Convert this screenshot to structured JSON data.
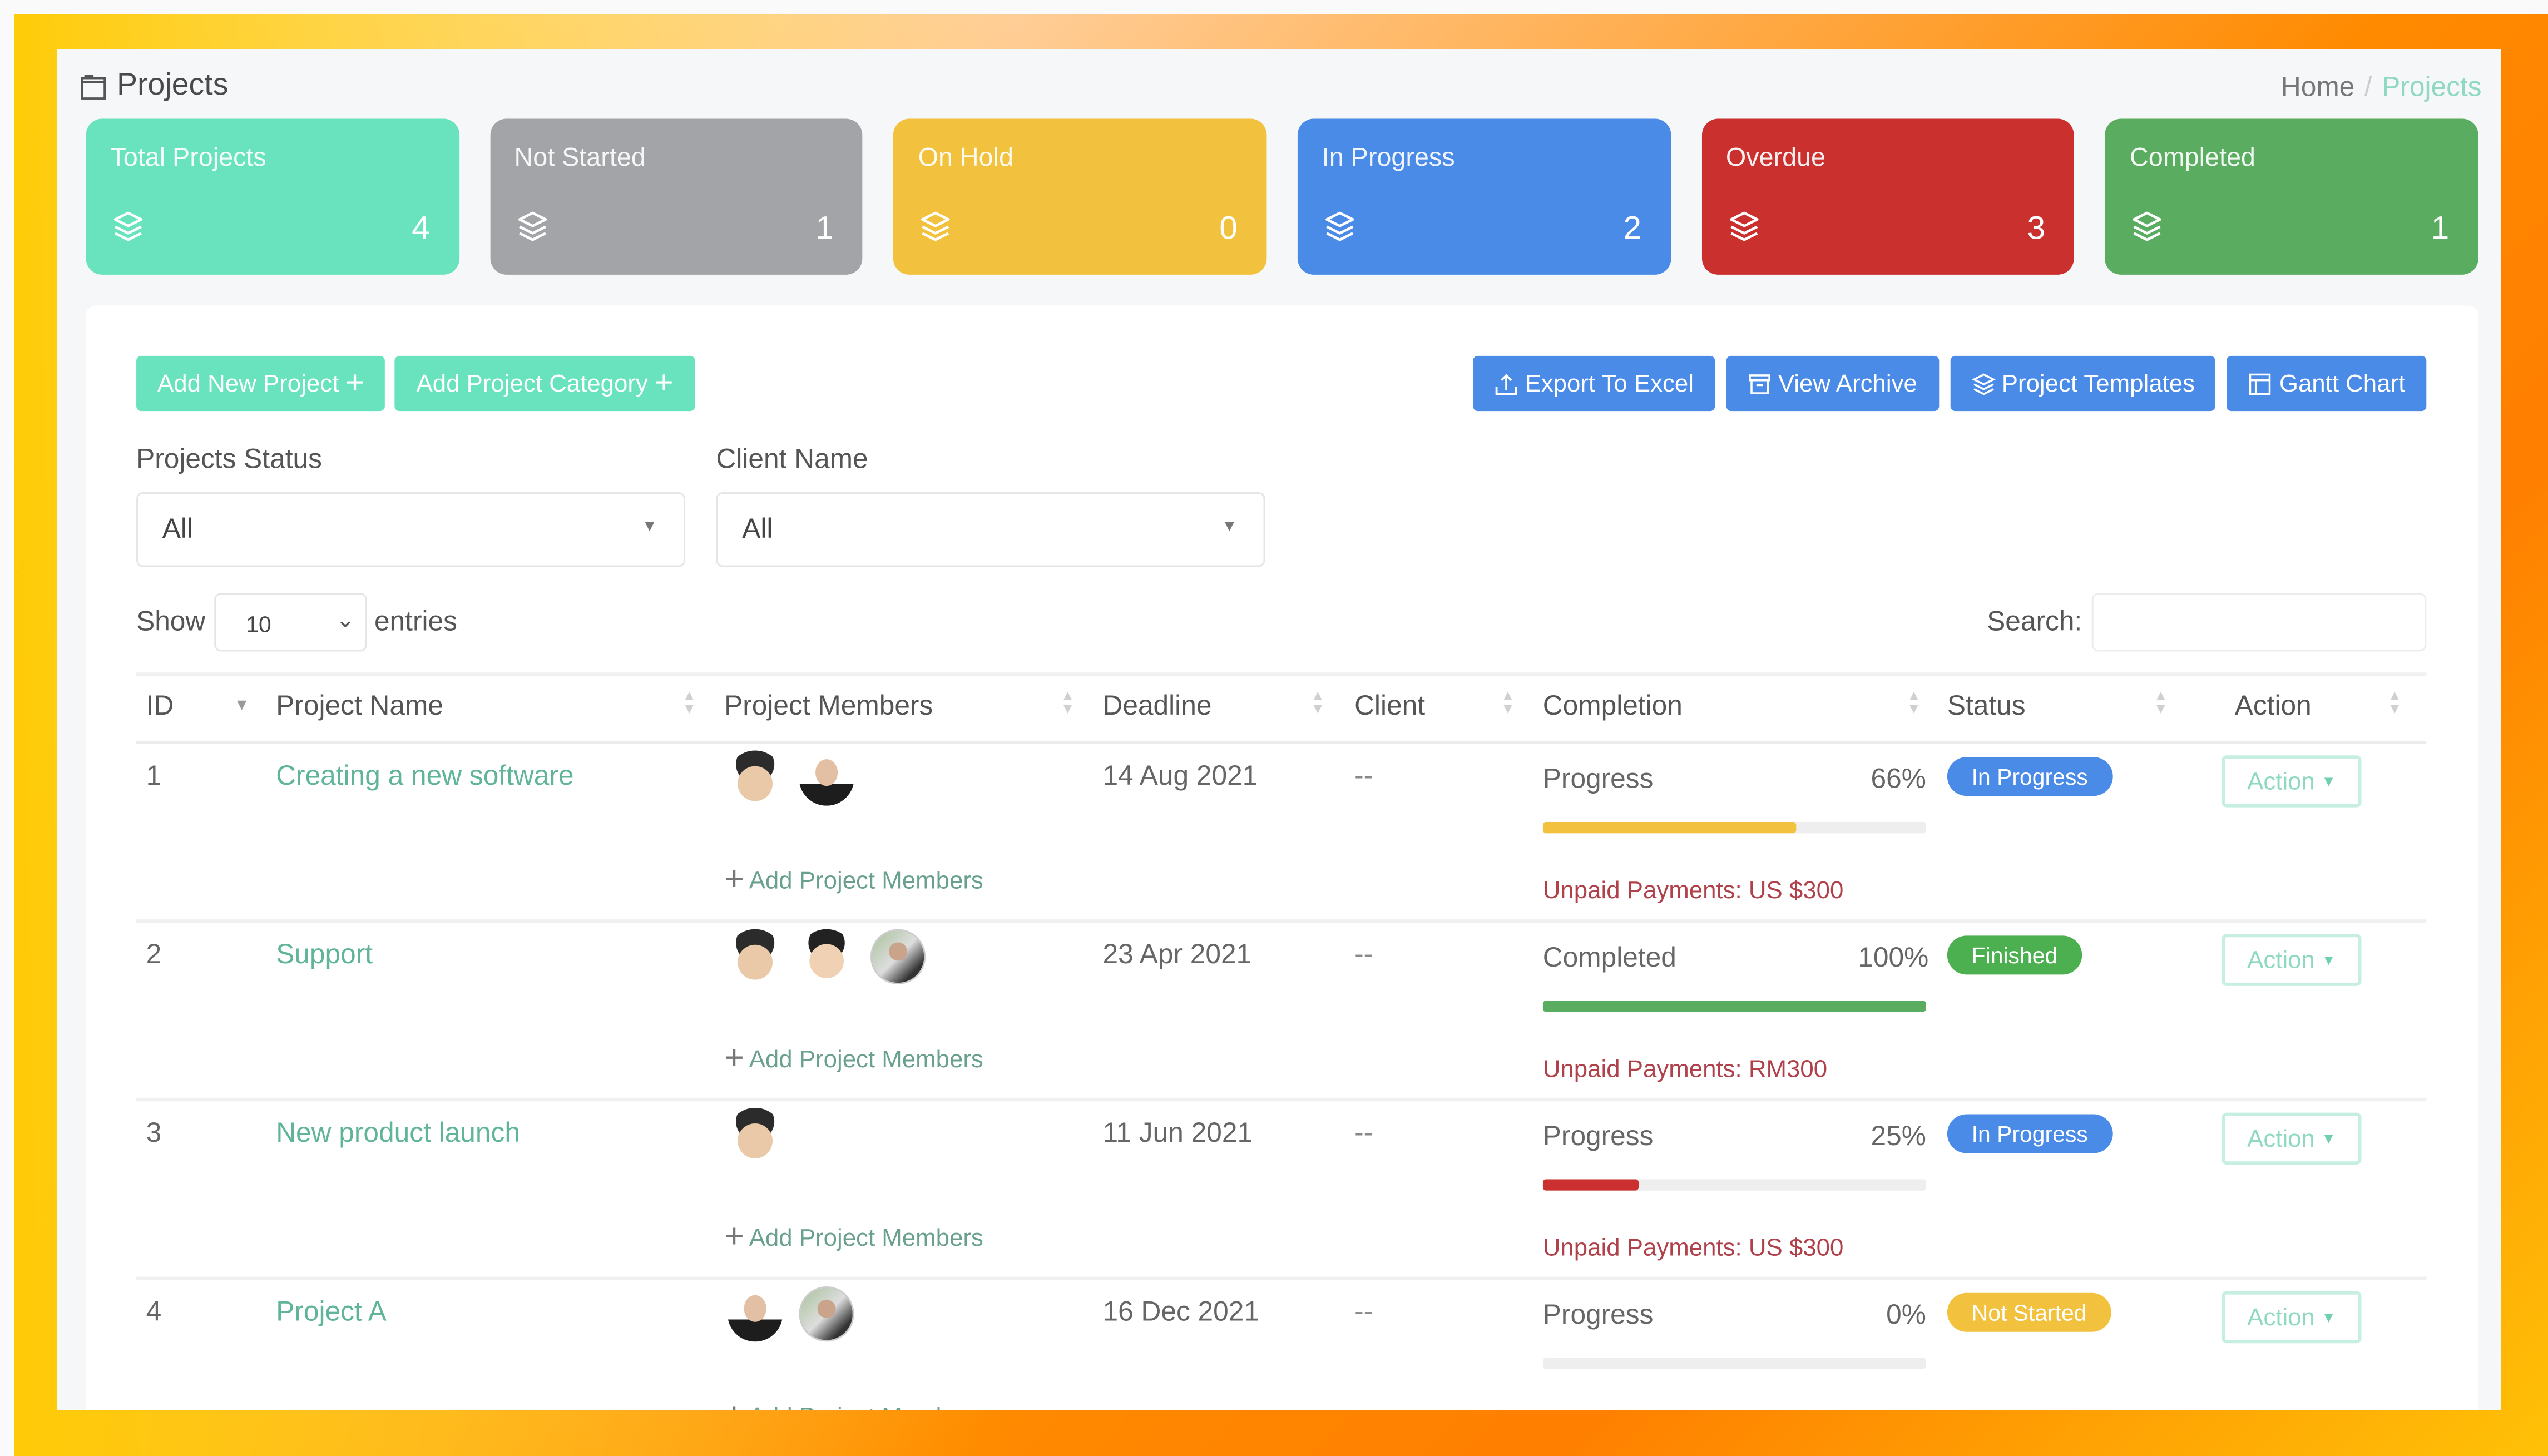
{
  "page": {
    "title": "Projects",
    "title_icon": "folder-icon",
    "breadcrumb": [
      {
        "label": "Home"
      },
      {
        "label": "Projects"
      }
    ],
    "breadcrumb_separator": "/"
  },
  "stats": [
    {
      "label": "Total Projects",
      "count": "4",
      "icon": "layers-icon",
      "color": "#69e3bd"
    },
    {
      "label": "Not Started",
      "count": "1",
      "icon": "layers-icon",
      "color": "#a2a4a8"
    },
    {
      "label": "On Hold",
      "count": "0",
      "icon": "layers-icon",
      "color": "#f2c23f"
    },
    {
      "label": "In Progress",
      "count": "2",
      "icon": "layers-icon",
      "color": "#4b8be8"
    },
    {
      "label": "Overdue",
      "count": "3",
      "icon": "layers-icon",
      "color": "#c9302e"
    },
    {
      "label": "Completed",
      "count": "1",
      "icon": "layers-icon",
      "color": "#5aad60"
    }
  ],
  "toolbar": {
    "add_project": "Add New Project",
    "add_category": "Add Project Category",
    "export": "Export To Excel",
    "archive": "View Archive",
    "templates": "Project Templates",
    "gantt": "Gantt Chart",
    "plus": "+"
  },
  "filters": {
    "status_label": "Projects Status",
    "status_value": "All",
    "client_label": "Client Name",
    "client_value": "All"
  },
  "table_controls": {
    "show_label": "Show",
    "entries_value": "10",
    "entries_label": "entries",
    "search_label": "Search:",
    "search_value": ""
  },
  "table": {
    "columns": [
      "ID",
      "Project Name",
      "Project Members",
      "Deadline",
      "Client",
      "Completion",
      "Status",
      "Action"
    ],
    "add_members_label": "Add Project Members",
    "action_label": "Action",
    "rows": [
      {
        "id": "1",
        "name": "Creating a new software",
        "members": [
          "memoji-a",
          "woman"
        ],
        "deadline": "14 Aug 2021",
        "client": "--",
        "completion_label": "Progress",
        "completion_pct_text": "66%",
        "completion": 0.66,
        "bar_color": "#f2c23f",
        "unpaid": "Unpaid Payments: US $300",
        "status": "In Progress",
        "status_color": "#4b8be8"
      },
      {
        "id": "2",
        "name": "Support",
        "members": [
          "memoji-a",
          "memoji-b",
          "photo"
        ],
        "deadline": "23 Apr 2021",
        "client": "--",
        "completion_label": "Completed",
        "completion_pct_text": "100%",
        "completion": 1.0,
        "bar_color": "#5aad60",
        "unpaid": "Unpaid Payments: RM300",
        "status": "Finished",
        "status_color": "#4caf50"
      },
      {
        "id": "3",
        "name": "New product launch",
        "members": [
          "memoji-a"
        ],
        "deadline": "11 Jun 2021",
        "client": "--",
        "completion_label": "Progress",
        "completion_pct_text": "25%",
        "completion": 0.25,
        "bar_color": "#c9302e",
        "unpaid": "Unpaid Payments: US $300",
        "status": "In Progress",
        "status_color": "#4b8be8"
      },
      {
        "id": "4",
        "name": "Project A",
        "members": [
          "woman",
          "photo"
        ],
        "deadline": "16 Dec 2021",
        "client": "--",
        "completion_label": "Progress",
        "completion_pct_text": "0%",
        "completion": 0.0,
        "bar_color": "#f2c23f",
        "unpaid": "",
        "status": "Not Started",
        "status_color": "#f2c23f"
      }
    ]
  }
}
